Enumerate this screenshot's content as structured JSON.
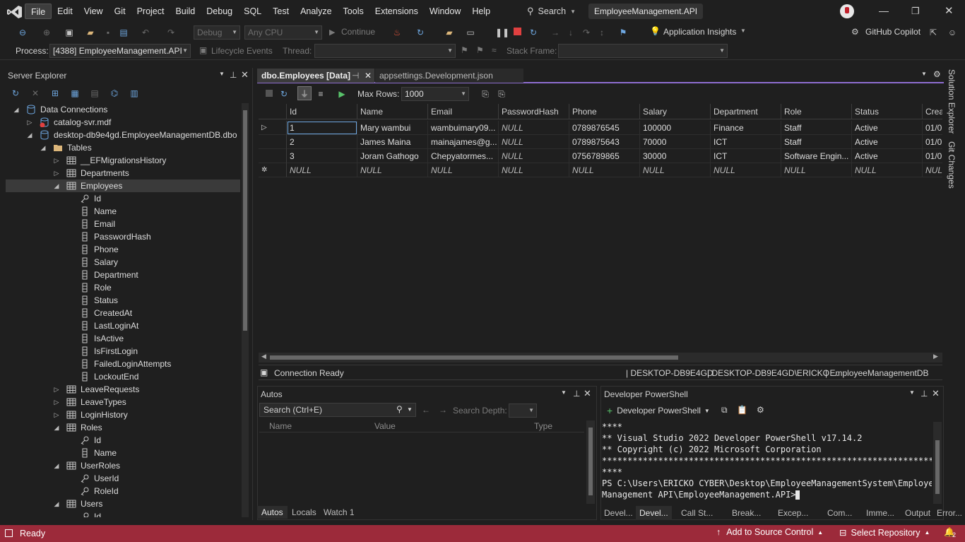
{
  "menu": {
    "items": [
      "File",
      "Edit",
      "View",
      "Git",
      "Project",
      "Build",
      "Debug",
      "SQL",
      "Test",
      "Analyze",
      "Tools",
      "Extensions",
      "Window",
      "Help"
    ],
    "search": "Search",
    "solution_name": "EmployeeManagement.API"
  },
  "toolbar": {
    "config": "Debug",
    "platform": "Any CPU",
    "continue": "Continue",
    "app_insights": "Application Insights",
    "copilot": "GitHub Copilot"
  },
  "debug_bar": {
    "process_label": "Process:",
    "process_value": "[4388] EmployeeManagement.API",
    "lifecycle": "Lifecycle Events",
    "thread_label": "Thread:",
    "stack_label": "Stack Frame:"
  },
  "server_explorer": {
    "title": "Server Explorer",
    "tree": [
      {
        "label": "Data Connections",
        "indent": 0,
        "exp": "open",
        "icon": "db"
      },
      {
        "label": "catalog-svr.mdf",
        "indent": 1,
        "exp": "closed",
        "icon": "dberr"
      },
      {
        "label": "desktop-db9e4gd.EmployeeManagementDB.dbo",
        "indent": 1,
        "exp": "open",
        "icon": "db"
      },
      {
        "label": "Tables",
        "indent": 2,
        "exp": "open",
        "icon": "folder"
      },
      {
        "label": "__EFMigrationsHistory",
        "indent": 3,
        "exp": "closed",
        "icon": "table"
      },
      {
        "label": "Departments",
        "indent": 3,
        "exp": "closed",
        "icon": "table"
      },
      {
        "label": "Employees",
        "indent": 3,
        "exp": "open",
        "icon": "table",
        "sel": true
      },
      {
        "label": "Id",
        "indent": 4,
        "icon": "key"
      },
      {
        "label": "Name",
        "indent": 4,
        "icon": "col"
      },
      {
        "label": "Email",
        "indent": 4,
        "icon": "col"
      },
      {
        "label": "PasswordHash",
        "indent": 4,
        "icon": "col"
      },
      {
        "label": "Phone",
        "indent": 4,
        "icon": "col"
      },
      {
        "label": "Salary",
        "indent": 4,
        "icon": "col"
      },
      {
        "label": "Department",
        "indent": 4,
        "icon": "col"
      },
      {
        "label": "Role",
        "indent": 4,
        "icon": "col"
      },
      {
        "label": "Status",
        "indent": 4,
        "icon": "col"
      },
      {
        "label": "CreatedAt",
        "indent": 4,
        "icon": "col"
      },
      {
        "label": "LastLoginAt",
        "indent": 4,
        "icon": "col"
      },
      {
        "label": "IsActive",
        "indent": 4,
        "icon": "col"
      },
      {
        "label": "IsFirstLogin",
        "indent": 4,
        "icon": "col"
      },
      {
        "label": "FailedLoginAttempts",
        "indent": 4,
        "icon": "col"
      },
      {
        "label": "LockoutEnd",
        "indent": 4,
        "icon": "col"
      },
      {
        "label": "LeaveRequests",
        "indent": 3,
        "exp": "closed",
        "icon": "table"
      },
      {
        "label": "LeaveTypes",
        "indent": 3,
        "exp": "closed",
        "icon": "table"
      },
      {
        "label": "LoginHistory",
        "indent": 3,
        "exp": "closed",
        "icon": "table"
      },
      {
        "label": "Roles",
        "indent": 3,
        "exp": "open",
        "icon": "table"
      },
      {
        "label": "Id",
        "indent": 4,
        "icon": "key"
      },
      {
        "label": "Name",
        "indent": 4,
        "icon": "col"
      },
      {
        "label": "UserRoles",
        "indent": 3,
        "exp": "open",
        "icon": "table"
      },
      {
        "label": "UserId",
        "indent": 4,
        "icon": "key"
      },
      {
        "label": "RoleId",
        "indent": 4,
        "icon": "key"
      },
      {
        "label": "Users",
        "indent": 3,
        "exp": "open",
        "icon": "table"
      },
      {
        "label": "Id",
        "indent": 4,
        "icon": "key"
      }
    ]
  },
  "editor": {
    "tabs": [
      "dbo.Employees [Data]",
      "appsettings.Development.json"
    ],
    "max_rows_label": "Max Rows:",
    "max_rows": "1000",
    "columns": [
      "Id",
      "Name",
      "Email",
      "PasswordHash",
      "Phone",
      "Salary",
      "Department",
      "Role",
      "Status",
      "Crea"
    ],
    "rows": [
      [
        "1",
        "Mary wambui",
        "wambuimary09...",
        "NULL",
        "0789876545",
        "100000",
        "Finance",
        "Staff",
        "Active",
        "01/0"
      ],
      [
        "2",
        "James Maina",
        "mainajames@g...",
        "NULL",
        "0789875643",
        "70000",
        "ICT",
        "Staff",
        "Active",
        "01/0"
      ],
      [
        "3",
        "Joram Gathogo",
        "Chepyatormes...",
        "NULL",
        "0756789865",
        "30000",
        "ICT",
        "Software Engin...",
        "Active",
        "01/0"
      ],
      [
        "NULL",
        "NULL",
        "NULL",
        "NULL",
        "NULL",
        "NULL",
        "NULL",
        "NULL",
        "NULL",
        "NULL"
      ]
    ],
    "status": "Connection Ready",
    "server": "DESKTOP-DB9E4GD",
    "user": "DESKTOP-DB9E4GD\\ERICKO ...",
    "database": "EmployeeManagementDB"
  },
  "autos": {
    "title": "Autos",
    "search_placeholder": "Search (Ctrl+E)",
    "search_depth": "Search Depth:",
    "col_name": "Name",
    "col_value": "Value",
    "col_type": "Type",
    "tabs": [
      "Autos",
      "Locals",
      "Watch 1"
    ]
  },
  "powershell": {
    "title": "Developer PowerShell",
    "dropdown": "Developer PowerShell",
    "lines": [
      "****",
      "** Visual Studio 2022 Developer PowerShell v17.14.2",
      "** Copyright (c) 2022 Microsoft Corporation",
      "******************************************************************",
      "****",
      "PS C:\\Users\\ERICKO CYBER\\Desktop\\EmployeeManagementSystem\\Employee",
      "Management API\\EmployeeManagement.API> "
    ],
    "tabs": [
      "Devel...",
      "Devel...",
      "Call St...",
      "Break...",
      "Excep...",
      "Com...",
      "Imme...",
      "Output",
      "Error..."
    ]
  },
  "side_tabs": [
    "Solution Explorer",
    "Git Changes"
  ],
  "statusbar": {
    "ready": "Ready",
    "source_control": "Add to Source Control",
    "repository": "Select Repository",
    "notifications": "2"
  }
}
